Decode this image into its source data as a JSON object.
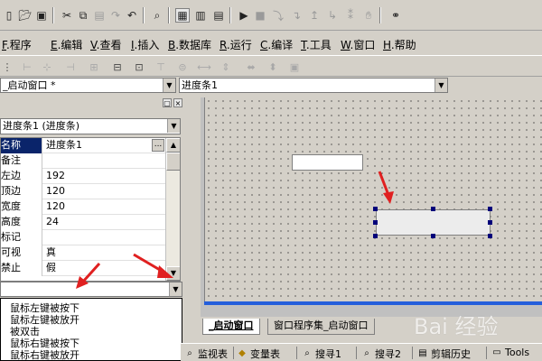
{
  "menubar": {
    "items": [
      {
        "key": "F",
        "label": ".程序"
      },
      {
        "key": "E",
        "label": ".编辑"
      },
      {
        "key": "V",
        "label": ".查看"
      },
      {
        "key": "I",
        "label": ".插入"
      },
      {
        "key": "B",
        "label": ".数据库"
      },
      {
        "key": "R",
        "label": ".运行"
      },
      {
        "key": "C",
        "label": ".编译"
      },
      {
        "key": "T",
        "label": ".工具"
      },
      {
        "key": "W",
        "label": ".窗口"
      },
      {
        "key": "H",
        "label": ".帮助"
      }
    ]
  },
  "combos": {
    "window_select": "_启动窗口 *",
    "control_select": "进度条1"
  },
  "properties": {
    "object_select": "进度条1 (进度条)",
    "rows": [
      {
        "name": "名称",
        "value": "进度条1"
      },
      {
        "name": "备注",
        "value": ""
      },
      {
        "name": "左边",
        "value": "192"
      },
      {
        "name": "顶边",
        "value": "120"
      },
      {
        "name": "宽度",
        "value": "120"
      },
      {
        "name": "高度",
        "value": "24"
      },
      {
        "name": "标记",
        "value": ""
      },
      {
        "name": "可视",
        "value": "真"
      },
      {
        "name": "禁止",
        "value": "假"
      }
    ],
    "ellipsis": "..."
  },
  "events": {
    "items": [
      "鼠标左键被按下",
      "鼠标左键被放开",
      "被双击",
      "鼠标右键被按下",
      "鼠标右键被放开"
    ]
  },
  "document_tabs": [
    "_启动窗口",
    "窗口程序集_启动窗口"
  ],
  "bottom_tabs": [
    "监视表",
    "变量表",
    "搜寻1",
    "搜寻2",
    "剪辑历史",
    "Tools"
  ],
  "watermark": "Bai 经验",
  "colors": {
    "selection": "#0a246a",
    "form_border": "#245edb",
    "arrow": "#e02020",
    "handle": "#00007a"
  }
}
